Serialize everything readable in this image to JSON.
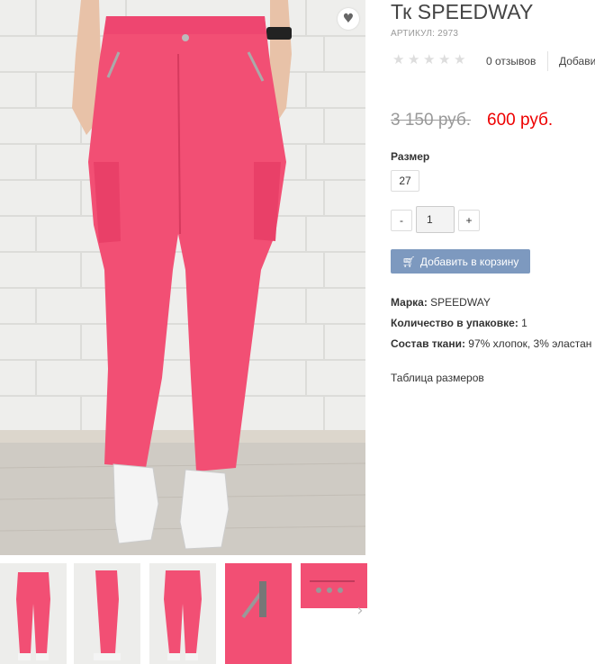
{
  "product": {
    "title": "Тк SPEEDWAY",
    "sku": "АРТИКУЛ: 2973",
    "rating": 0,
    "reviews_label": "0 отзывов",
    "add_review_label": "Добави",
    "price_old": "3 150 руб.",
    "price_new": "600 руб.",
    "wishlist_icon": "heart-icon"
  },
  "options": {
    "size_label": "Размер",
    "sizes": [
      "27"
    ]
  },
  "quantity": {
    "minus_label": "-",
    "value": "1",
    "plus_label": "+"
  },
  "cart": {
    "icon": "cart-icon",
    "label": "Добавить в корзину"
  },
  "specs": [
    {
      "key": "Марка:",
      "value": " SPEEDWAY"
    },
    {
      "key": "Количество в упаковке:",
      "value": " 1"
    },
    {
      "key": "Состав ткани:",
      "value": " 97% хлопок, 3% эластан"
    }
  ],
  "size_table_link": "Таблица размеров",
  "thumbnails": [
    "front-view",
    "side-view",
    "back-view",
    "zipper-detail",
    "studs-detail"
  ],
  "colors": {
    "accent_pink": "#f24f74",
    "price_red": "#e00000",
    "cart_button": "#7d99bf"
  }
}
